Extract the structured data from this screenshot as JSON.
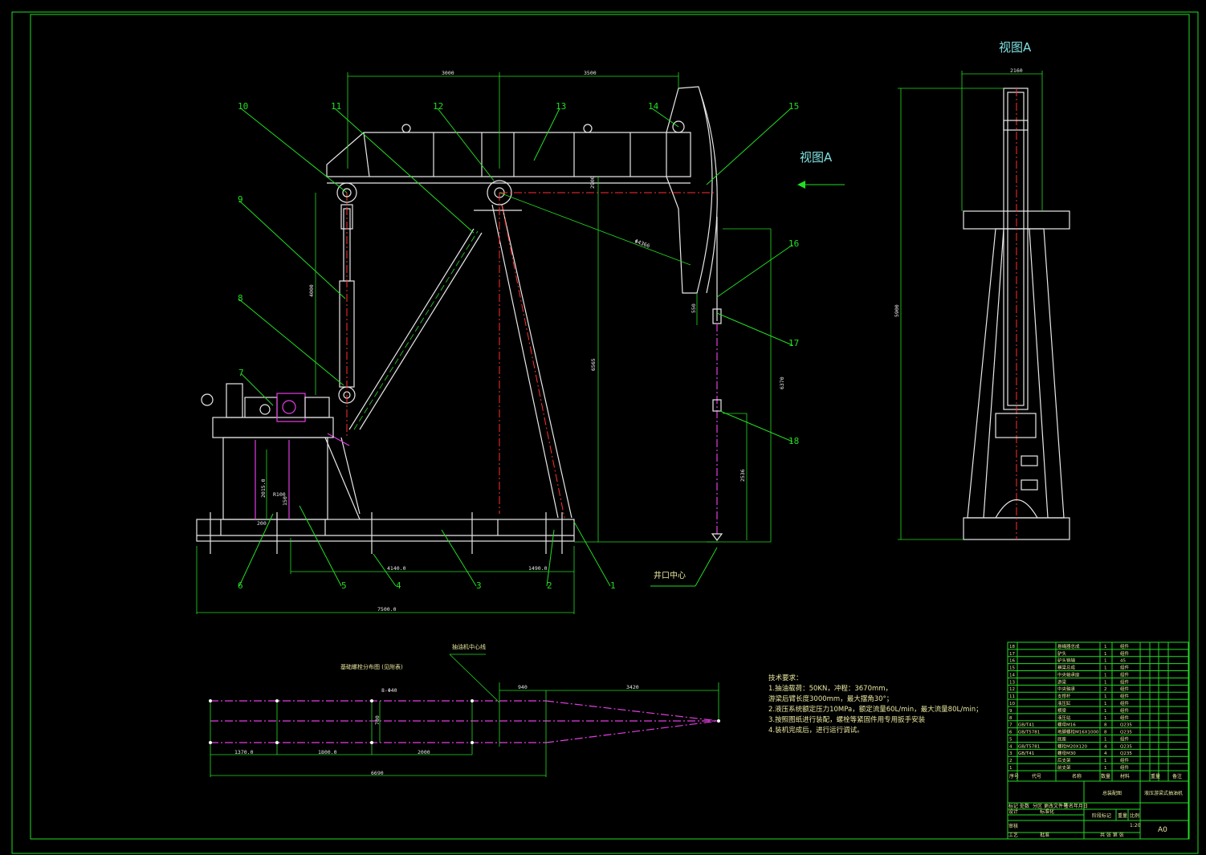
{
  "view_labels": {
    "side_view_title": "视图A",
    "arrow_label": "视图A",
    "wellhead": "井口中心"
  },
  "part_numbers": [
    "1",
    "2",
    "3",
    "4",
    "5",
    "6",
    "7",
    "8",
    "9",
    "10",
    "11",
    "12",
    "13",
    "14",
    "15",
    "16",
    "17",
    "18"
  ],
  "dimensions": {
    "d3000": "3000",
    "d3500": "3500",
    "d2900": "2900",
    "d4000": "4000",
    "d6565": "6565",
    "d4366": "Φ4366",
    "d2015": "2015.0",
    "dR100": "R100",
    "d150": "150",
    "d200": "200",
    "d4140": "4140.0",
    "d1490": "1490.0",
    "d7500": "7500.0",
    "d6370": "6370",
    "d550": "550",
    "d2536": "2536",
    "d2160": "2160",
    "d5900": "5900",
    "s_phi": "8-Φ40",
    "s_940": "940",
    "s_3420": "3420",
    "s_780": "780",
    "s_1370": "1370.0",
    "s_1800": "1800.0",
    "s_2000": "2000",
    "s_6690": "6690"
  },
  "foundation_notes": {
    "note_left": "基础螺栓分布图 (见附表)",
    "note_center": "抽油机中心线"
  },
  "tech_requirements": {
    "title": "技术要求：",
    "lines": [
      "1.抽油载荷：50KN，冲程：3670mm，",
      "游梁后臂长度3000mm，最大摆角30°；",
      "2.液压系统额定压力10MPa，额定流量60L/min，最大流量80L/min；",
      "3.按照图纸进行装配，螺栓等紧固件用专用扳手安装",
      "4.装机完成后，进行运行调试。"
    ]
  },
  "title_block": {
    "bom_numbers": [
      "18",
      "17",
      "16",
      "15",
      "14",
      "13",
      "12",
      "11",
      "10",
      "9",
      "8",
      "7",
      "6",
      "5",
      "4",
      "3",
      "2",
      "1"
    ],
    "bom_codes": [
      "",
      "",
      "",
      "",
      "",
      "",
      "",
      "",
      "",
      "",
      "",
      "GB/T41",
      "GB/T5781",
      "",
      "GB/T5781",
      "GB/T41",
      "",
      ""
    ],
    "bom_names": [
      "悬绳器总成",
      "驴头",
      "驴头销轴",
      "横梁总成",
      "中央轴承座",
      "游梁",
      "中央轴承",
      "支撑杆",
      "液压缸",
      "横梁",
      "液压站",
      "螺母M16",
      "地脚螺栓M16X1000",
      "底座",
      "螺栓M20X120",
      "螺母M30",
      "后支架",
      "前支架"
    ],
    "bom_qty": [
      "1",
      "1",
      "1",
      "1",
      "1",
      "1",
      "2",
      "1",
      "1",
      "1",
      "1",
      "8",
      "8",
      "1",
      "4",
      "4",
      "1",
      "1"
    ],
    "bom_material": [
      "组件",
      "组件",
      "45",
      "组件",
      "组件",
      "组件",
      "组件",
      "组件",
      "组件",
      "组件",
      "组件",
      "Q235",
      "Q235",
      "组件",
      "Q235",
      "Q235",
      "组件",
      "组件"
    ],
    "hdr_no": "序号",
    "hdr_code": "代号",
    "hdr_name": "名称",
    "hdr_qty": "数量",
    "hdr_mat": "材料",
    "hdr_weight": "重量",
    "hdr_note": "备注",
    "assembly_label": "总装配图",
    "title": "液压游梁式抽油机",
    "scale": "1:20",
    "sheet": "A0",
    "b_mark": "标记",
    "b_count": "处数",
    "b_zone": "分区",
    "b_change": "更改文件号",
    "b_sign": "签名",
    "b_date": "年月日",
    "b_design": "设计",
    "b_std": "标准化",
    "b_stage": "阶段标记",
    "b_weight": "重量",
    "b_ratio": "比例",
    "b_check": "审核",
    "b_process": "工艺",
    "b_approve": "批准",
    "b_sheets": "共 张 第 张"
  }
}
